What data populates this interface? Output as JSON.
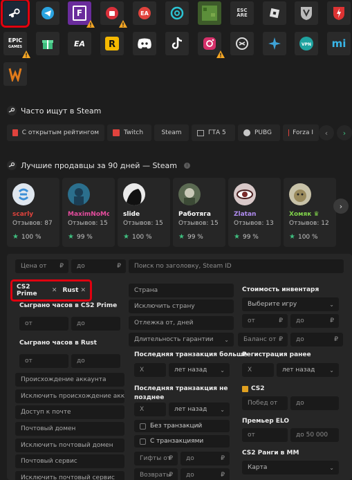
{
  "apps": [
    {
      "id": "steam",
      "label": "",
      "icon": "steam-icon",
      "selected": true,
      "warning": false
    },
    {
      "id": "telegram",
      "label": "",
      "icon": "telegram-icon",
      "selected": false,
      "warning": false
    },
    {
      "id": "fortnite",
      "label": "F",
      "icon": "fortnite-icon",
      "selected": false,
      "warning": true
    },
    {
      "id": "supercell",
      "label": "",
      "icon": "supercell-icon",
      "selected": false,
      "warning": true
    },
    {
      "id": "ea",
      "label": "EA",
      "icon": "ea-icon",
      "selected": false,
      "warning": false
    },
    {
      "id": "uplay",
      "label": "",
      "icon": "ubisoft-icon",
      "selected": false,
      "warning": false
    },
    {
      "id": "minecraft",
      "label": "",
      "icon": "minecraft-icon",
      "selected": false,
      "warning": false
    },
    {
      "id": "escape",
      "label": "",
      "icon": "escape-from-tarkov-icon",
      "selected": false,
      "warning": false
    },
    {
      "id": "roblox",
      "label": "",
      "icon": "roblox-icon",
      "selected": false,
      "warning": false
    },
    {
      "id": "wot",
      "label": "",
      "icon": "world-of-tanks-icon",
      "selected": false,
      "warning": false
    },
    {
      "id": "wotblitz",
      "label": "",
      "icon": "wot-blitz-icon",
      "selected": false,
      "warning": false
    },
    {
      "id": "epic",
      "label": "EPIC",
      "icon": "epic-games-icon",
      "selected": false,
      "warning": true
    },
    {
      "id": "gifts",
      "label": "",
      "icon": "gift-icon",
      "selected": false,
      "warning": false
    },
    {
      "id": "ea-mobile",
      "label": "EA",
      "icon": "ea-app-icon",
      "selected": false,
      "warning": false
    },
    {
      "id": "rockstar",
      "label": "R",
      "icon": "rockstar-icon",
      "selected": false,
      "warning": false
    },
    {
      "id": "discord",
      "label": "",
      "icon": "discord-icon",
      "selected": false,
      "warning": false
    },
    {
      "id": "tiktok",
      "label": "",
      "icon": "tiktok-icon",
      "selected": false,
      "warning": false
    },
    {
      "id": "instagram",
      "label": "",
      "icon": "instagram-icon",
      "selected": false,
      "warning": true
    },
    {
      "id": "chatgpt",
      "label": "",
      "icon": "chatgpt-icon",
      "selected": false,
      "warning": false
    },
    {
      "id": "genshin",
      "label": "",
      "icon": "hoyoverse-icon",
      "selected": false,
      "warning": false
    },
    {
      "id": "vpn",
      "label": "",
      "icon": "vpn-icon",
      "selected": false,
      "warning": false
    },
    {
      "id": "mi",
      "label": "mi",
      "icon": "mihoyo-icon",
      "selected": false,
      "warning": false
    },
    {
      "id": "warface",
      "label": "",
      "icon": "warface-icon",
      "selected": false,
      "warning": false
    }
  ],
  "popular": {
    "title": "Часто ищут в Steam",
    "chips": [
      {
        "label": "С открытым рейтингом",
        "icon": "cs2-rating-icon"
      },
      {
        "label": "Twitch",
        "icon": "twitch-icon"
      },
      {
        "label": "Steam",
        "icon": ""
      },
      {
        "label": "ГТА 5",
        "icon": "gta5-icon"
      },
      {
        "label": "PUBG",
        "icon": "pubg-icon"
      },
      {
        "label": "Forza I",
        "icon": "forza-icon"
      }
    ]
  },
  "sellers": {
    "title": "Лучшие продавцы за 90 дней — Steam",
    "items": [
      {
        "name": "scarly",
        "reviews": "Отзывов: 87",
        "rating": "100 %",
        "color": "#e0433d"
      },
      {
        "name": "MaximNoMore",
        "reviews": "Отзывов: 15",
        "rating": "99 %",
        "color": "#e54d9e"
      },
      {
        "name": "slide",
        "reviews": "Отзывов: 15",
        "rating": "100 %",
        "color": "#ffffff"
      },
      {
        "name": "Работяга",
        "reviews": "Отзывов: 15",
        "rating": "99 %",
        "color": "#ffffff"
      },
      {
        "name": "Zlatan",
        "reviews": "Отзывов: 13",
        "rating": "99 %",
        "color": "#b08cf0"
      },
      {
        "name": "Хомяк",
        "reviews": "Отзывов: 12",
        "rating": "100 %",
        "color": "#7fd14a"
      }
    ]
  },
  "filters": {
    "price_from": "Цена от",
    "price_to": "до",
    "currency": "₽",
    "search_placeholder": "Поиск по заголовку, Steam ID",
    "tags": [
      "CS2 Prime",
      "Rust"
    ],
    "hours_cs2_label": "Сыграно часов в CS2 Prime",
    "hours_rust_label": "Сыграно часов в Rust",
    "from": "от",
    "to": "до",
    "origin": "Происхождение аккаунта",
    "exclude_origin": "Исключить происхождение аккаун",
    "mail_access": "Доступ к почте",
    "mail_domain": "Почтовый домен",
    "exclude_mail_domain": "Исключить почтовый домен",
    "mail_service": "Почтовый сервис",
    "exclude_mail_service": "Исключить почтовый сервис",
    "country": "Страна",
    "exclude_country": "Исключить страну",
    "idle_days": "Отлежка от, дней",
    "warranty": "Длительность гарантии",
    "last_tx_label": "Последняя транзакция больше",
    "last_tx_late_label": "Последняя транзакция не позднее",
    "x": "X",
    "ago": "лет назад",
    "no_tx": "Без транзакций",
    "with_tx": "С транзакциями",
    "gifts_from": "Гифты от",
    "refunds_from": "Возвраты",
    "inventory_label": "Стоимость инвентаря",
    "choose_game": "Выберите игру",
    "balance_from": "Баланс от",
    "reg_label": "Регистрация ранее",
    "cs2_label": "CS2",
    "wins_from": "Побед от",
    "premier_label": "Премьер ELO",
    "premier_to": "до 50 000",
    "ranks_label": "CS2 Ранги в ММ",
    "map": "Карта"
  }
}
